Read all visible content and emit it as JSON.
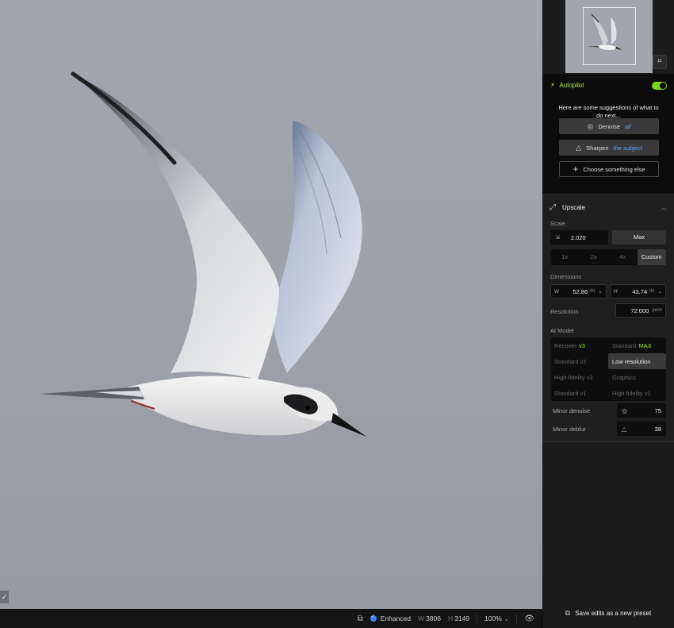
{
  "canvas": {
    "corner_check": "✓"
  },
  "status_bar": {
    "enhanced_label": "Enhanced",
    "width_label": "W",
    "width_value": "3806",
    "height_label": "H",
    "height_value": "3149",
    "zoom": "100%"
  },
  "autopilot": {
    "title": "Autopilot",
    "enabled": true,
    "message": "Here are some suggestions of what to do next...",
    "suggestions": [
      {
        "verb": "Denoise",
        "target": "all"
      },
      {
        "verb": "Sharpen",
        "target": "the subject"
      }
    ],
    "choose_label": "Choose something else"
  },
  "upscale": {
    "title": "Upscale",
    "scale_label": "Scale",
    "scale_value": "2.020",
    "max_label": "Max",
    "scale_options": [
      "1x",
      "2x",
      "4x",
      "Custom"
    ],
    "scale_active": "Custom",
    "dimensions_label": "Dimensions",
    "width_prefix": "W",
    "width_value": "52.86",
    "height_prefix": "H",
    "height_value": "43.74",
    "unit": "IN",
    "resolution_label": "Resolution",
    "resolution_value": "72.000",
    "resolution_unit": "px/in",
    "ai_model_label": "AI Model",
    "models": [
      {
        "name": "Recover",
        "tag": "v3"
      },
      {
        "name": "Standard",
        "tag": "MAX"
      },
      {
        "name": "Standard v2",
        "tag": ""
      },
      {
        "name": "Low resolution",
        "tag": ""
      },
      {
        "name": "High fidelity v2",
        "tag": ""
      },
      {
        "name": "Graphics",
        "tag": ""
      },
      {
        "name": "Standard v1",
        "tag": ""
      },
      {
        "name": "High fidelity v1",
        "tag": ""
      }
    ],
    "model_active": "Low resolution",
    "minor_denoise_label": "Minor denoise",
    "minor_denoise_value": "75",
    "minor_deblur_label": "Minor deblur",
    "minor_deblur_value": "38"
  },
  "save_preset_label": "Save edits as a new preset",
  "colors": {
    "accent_green": "#9be52f",
    "accent_blue": "#3b82f6",
    "sky": "#9ea1a9"
  }
}
